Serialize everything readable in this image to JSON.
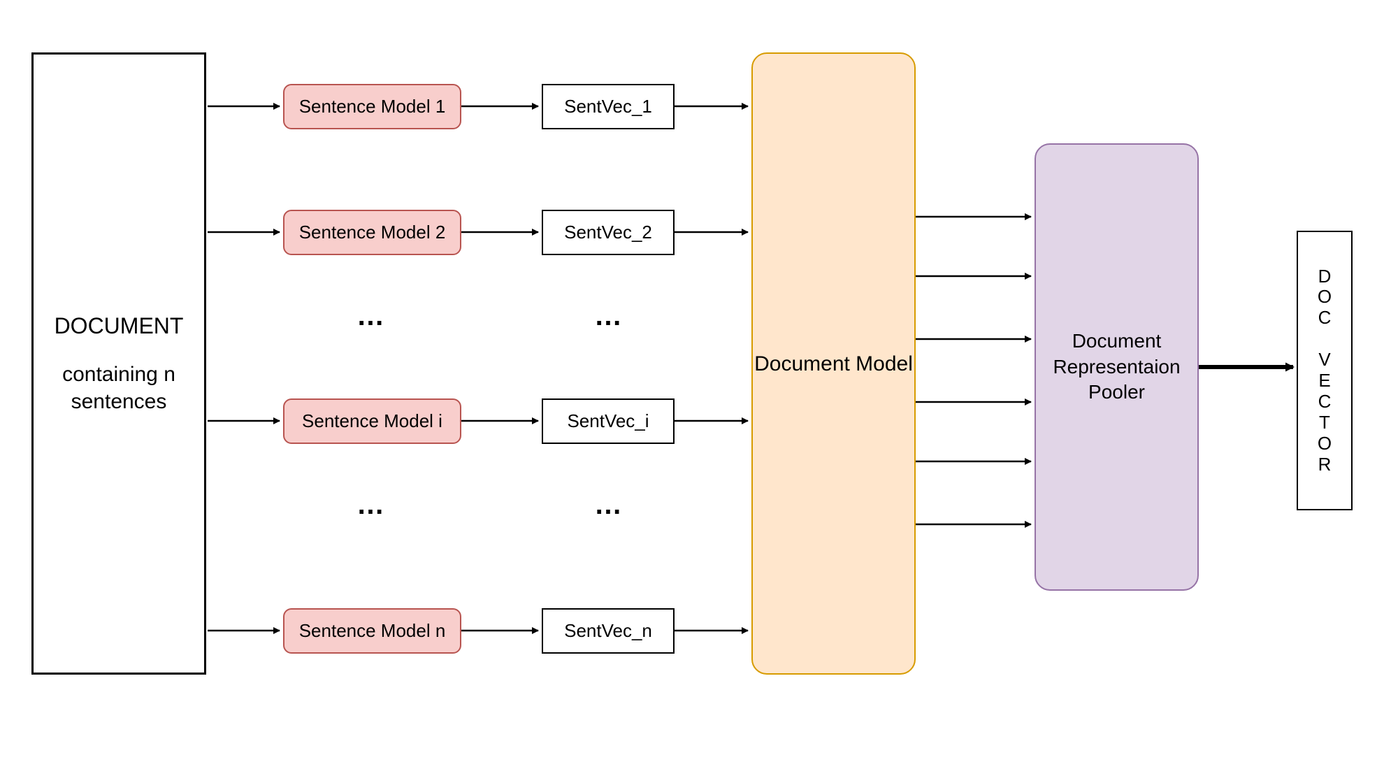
{
  "document": {
    "title": "DOCUMENT",
    "subtitle": "containing n sentences"
  },
  "rows": [
    {
      "model": "Sentence Model 1",
      "vec": "SentVec_1"
    },
    {
      "model": "Sentence Model 2",
      "vec": "SentVec_2"
    },
    {
      "model": "Sentence Model i",
      "vec": "SentVec_i"
    },
    {
      "model": "Sentence Model n",
      "vec": "SentVec_n"
    }
  ],
  "ellipsis": "…",
  "doc_model": "Document Model",
  "pooler": "Document Representaion Pooler",
  "doc_vector_chars": [
    "D",
    "O",
    "C",
    " ",
    "V",
    "E",
    "C",
    "T",
    "O",
    "R"
  ]
}
